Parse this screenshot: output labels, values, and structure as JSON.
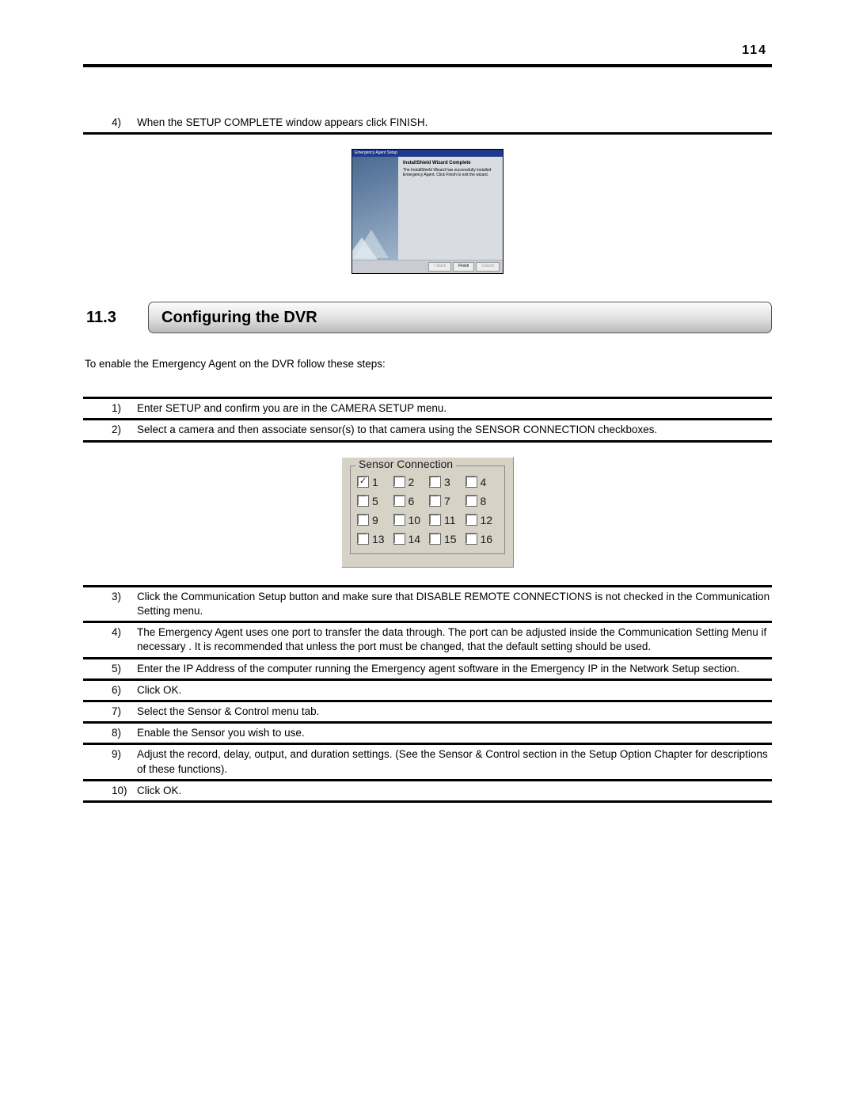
{
  "page_number": "114",
  "top_steps": [
    {
      "num": "4)",
      "text": "When the SETUP COMPLETE window appears click FINISH."
    }
  ],
  "install": {
    "titlebar": "Emergency Agent Setup",
    "heading": "InstallShield Wizard Complete",
    "body": "The InstallShield Wizard has successfully installed Emergency Agent. Click Finish to exit the wizard.",
    "buttons": [
      "< Back",
      "Finish",
      "Cancel"
    ]
  },
  "section": {
    "number": "11.3",
    "title": "Configuring the DVR",
    "intro": "To enable the Emergency Agent on the DVR follow these steps:"
  },
  "dvr_steps": [
    {
      "num": "1)",
      "text": "Enter SETUP and confirm you are in the CAMERA SETUP menu."
    },
    {
      "num": "2)",
      "text": "Select a camera and then associate sensor(s) to that camera using the SENSOR CONNECTION checkboxes."
    },
    {
      "num": "3)",
      "text": "Click the Communication Setup button and make sure that DISABLE REMOTE CONNECTIONS is not checked in the Communication Setting menu."
    },
    {
      "num": "4)",
      "text": "The Emergency Agent uses one port to transfer the data through. The port can be adjusted inside the Communication Setting Menu  if necessary . It is recommended that unless the port must be changed, that the default setting should be used."
    },
    {
      "num": "5)",
      "text": "Enter the IP Address of the computer running the Emergency agent software in the Emergency IP in the Network Setup section."
    },
    {
      "num": "6)",
      "text": "Click OK."
    },
    {
      "num": "7)",
      "text": "Select the Sensor & Control menu tab."
    },
    {
      "num": "8)",
      "text": "Enable the Sensor you wish to use."
    },
    {
      "num": "9)",
      "text": "Adjust the record, delay, output, and duration settings. (See the Sensor & Control section in the Setup Option Chapter for descriptions of these functions)."
    },
    {
      "num": "10)",
      "text": "Click OK."
    }
  ],
  "sensor": {
    "legend": "Sensor Connection",
    "items": [
      {
        "label": "1",
        "checked": true
      },
      {
        "label": "2",
        "checked": false
      },
      {
        "label": "3",
        "checked": false
      },
      {
        "label": "4",
        "checked": false
      },
      {
        "label": "5",
        "checked": false
      },
      {
        "label": "6",
        "checked": false
      },
      {
        "label": "7",
        "checked": false
      },
      {
        "label": "8",
        "checked": false
      },
      {
        "label": "9",
        "checked": false
      },
      {
        "label": "10",
        "checked": false
      },
      {
        "label": "11",
        "checked": false
      },
      {
        "label": "12",
        "checked": false
      },
      {
        "label": "13",
        "checked": false
      },
      {
        "label": "14",
        "checked": false
      },
      {
        "label": "15",
        "checked": false
      },
      {
        "label": "16",
        "checked": false
      }
    ]
  }
}
